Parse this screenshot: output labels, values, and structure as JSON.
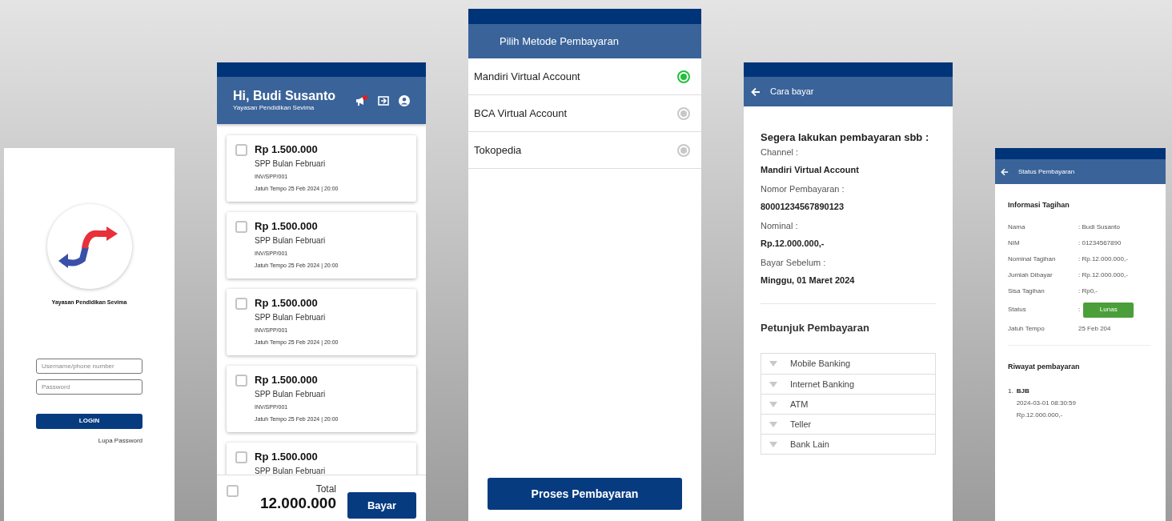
{
  "login": {
    "org_name": "Yayasan Pendidikan Sevima",
    "username_placeholder": "Username/phone number",
    "password_placeholder": "Password",
    "login_button": "LOGIN",
    "forgot_password": "Lupa Password"
  },
  "dashboard": {
    "greeting": "Hi, Budi Susanto",
    "subtitle": "Yayasan Pendidikan Sevima",
    "bills": [
      {
        "amount": "Rp 1.500.000",
        "description": "SPP Bulan Februari",
        "invoice": "INV/SPP/001",
        "due": "Jatuh Tempo 25 Feb 2024 | 20:00",
        "checked": false
      },
      {
        "amount": "Rp 1.500.000",
        "description": "SPP Bulan Februari",
        "invoice": "INV/SPP/001",
        "due": "Jatuh Tempo 25 Feb 2024 | 20:00",
        "checked": false
      },
      {
        "amount": "Rp 1.500.000",
        "description": "SPP Bulan Februari",
        "invoice": "INV/SPP/001",
        "due": "Jatuh Tempo 25 Feb 2024 | 20:00",
        "checked": false
      },
      {
        "amount": "Rp 1.500.000",
        "description": "SPP Bulan Februari",
        "invoice": "INV/SPP/001",
        "due": "Jatuh Tempo 25 Feb 2024 | 20:00",
        "checked": false
      },
      {
        "amount": "Rp 1.500.000",
        "description": "SPP Bulan Februari",
        "checked": false
      }
    ],
    "footer": {
      "select_all_checked": false,
      "total_label": "Total",
      "total": "12.000.000",
      "pay_button": "Bayar"
    }
  },
  "payment_methods": {
    "title": "Pilih Metode Pembayaran",
    "options": [
      {
        "label": "Mandiri Virtual Account",
        "selected": true
      },
      {
        "label": "BCA Virtual Account",
        "selected": false
      },
      {
        "label": "Tokopedia",
        "selected": false
      }
    ],
    "button": "Proses Pembayaran"
  },
  "payment_instructions": {
    "title": "Cara bayar",
    "heading": "Segera lakukan pembayaran sbb :",
    "fields": [
      {
        "label": "Channel :",
        "value": "Mandiri Virtual Account"
      },
      {
        "label": "Nomor Pembayaran :",
        "value": "80001234567890123"
      },
      {
        "label": "Nominal :",
        "value": "Rp.12.000.000,-"
      },
      {
        "label": "Bayar Sebelum :",
        "value": "Minggu, 01 Maret  2024"
      }
    ],
    "guide_title": "Petunjuk Pembayaran",
    "guides": [
      "Mobile Banking",
      "Internet Banking",
      "ATM",
      "Teller",
      "Bank Lain"
    ]
  },
  "payment_status": {
    "title": "Status Pembayaran",
    "section_title": "Informasi Tagihan",
    "rows": [
      {
        "kind": "text",
        "label": "Nama",
        "value": ": Budi Susanto"
      },
      {
        "kind": "text",
        "label": "NIM",
        "value": ": 01234567890"
      },
      {
        "kind": "text",
        "label": "Nominal Tagihan",
        "value": ": Rp.12.000.000,-"
      },
      {
        "kind": "text",
        "label": "Jumlah Dibayar",
        "value": ": Rp.12.000.000,-"
      },
      {
        "kind": "text",
        "label": "Sisa Tagihan",
        "value": ": Rp0,-"
      },
      {
        "kind": "badge",
        "label": "Status",
        "prefix": ":",
        "value": "Lunas"
      },
      {
        "kind": "text",
        "label": "Jatuh Tempo",
        "value": "25 Feb 204"
      }
    ],
    "history_title": "Riwayat pembayaran",
    "history": [
      {
        "number": "1.",
        "bank": "BJB",
        "datetime": "2024-03-01 08:30:59",
        "amount": "Rp.12.000.000,-"
      }
    ]
  }
}
